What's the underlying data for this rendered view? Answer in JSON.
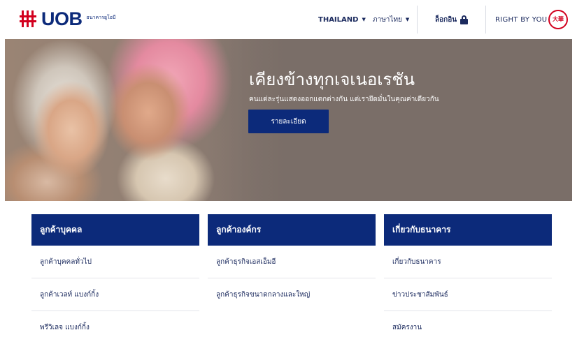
{
  "header": {
    "logo_text": "UOB",
    "logo_subtitle": "ธนาคารยูโอบี",
    "country_label": "THAILAND",
    "language_label": "ภาษาไทย",
    "login_label": "ล็อกอิน",
    "tagline": "RIGHT BY YOU",
    "seal_text": "大華"
  },
  "hero": {
    "title": "เคียงข้างทุกเจเนอเรชัน",
    "subtitle": "คนแต่ละรุ่นแสดงออกแตกต่างกัน แต่เรายึดมั่นในคุณค่าเดียวกัน",
    "button_label": "รายละเอียด"
  },
  "columns": [
    {
      "heading": "ลูกค้าบุคคล",
      "items": [
        "ลูกค้าบุคคลทั่วไป",
        "ลูกค้าเวลท์ แบงก์กิ้ง",
        "พรีวิเลจ แบงก์กิ้ง"
      ]
    },
    {
      "heading": "ลูกค้าองค์กร",
      "items": [
        "ลูกค้าธุรกิจเอสเอ็มอี",
        "ลูกค้าธุรกิจขนาดกลางและใหญ่"
      ]
    },
    {
      "heading": "เกี่ยวกับธนาคาร",
      "items": [
        "เกี่ยวกับธนาคาร",
        "ข่าวประชาสัมพันธ์",
        "สมัครงาน"
      ]
    }
  ],
  "colors": {
    "brand_navy": "#0c2a7a",
    "brand_red": "#d2001e"
  }
}
